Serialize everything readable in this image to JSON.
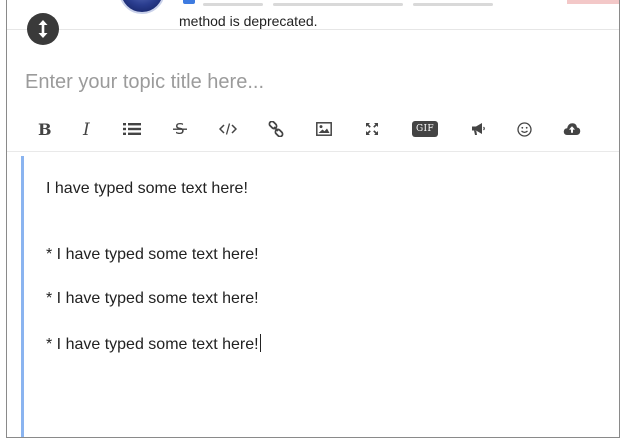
{
  "post": {
    "text": "method is deprecated."
  },
  "composer": {
    "title_placeholder": "Enter your topic title here..."
  },
  "toolbar": {
    "buttons": [
      {
        "name": "bold",
        "icon": "bold-icon"
      },
      {
        "name": "italic",
        "icon": "italic-icon"
      },
      {
        "name": "bulleted-list",
        "icon": "list-icon"
      },
      {
        "name": "strikethrough",
        "icon": "strikethrough-icon"
      },
      {
        "name": "code",
        "icon": "code-icon"
      },
      {
        "name": "link",
        "icon": "link-icon"
      },
      {
        "name": "image",
        "icon": "image-icon"
      },
      {
        "name": "fullscreen",
        "icon": "expand-icon"
      },
      {
        "name": "gif",
        "icon": "gif-icon",
        "label": "GIF"
      },
      {
        "name": "announcement",
        "icon": "bullhorn-icon"
      },
      {
        "name": "emoji",
        "icon": "smile-icon"
      },
      {
        "name": "upload",
        "icon": "cloud-upload-icon"
      }
    ]
  },
  "editor": {
    "lines": [
      "I have typed some text here!",
      "* I have typed some text here!",
      "* I have typed some text here!",
      "* I have typed some text here!"
    ]
  },
  "colors": {
    "editor_accent": "#8ab4f0",
    "icon": "#555555",
    "placeholder": "#9b9b9b",
    "grippie": "#3a3a3a"
  }
}
